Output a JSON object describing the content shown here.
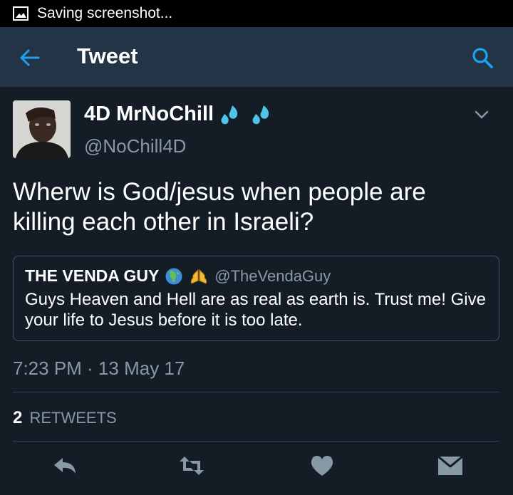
{
  "status_bar": {
    "icon": "image-icon",
    "text": "Saving screenshot..."
  },
  "app_bar": {
    "back_icon": "arrow-left-icon",
    "title": "Tweet",
    "search_icon": "search-icon",
    "accent_color": "#1da1f2"
  },
  "tweet": {
    "author_name": "4D MrNoChill",
    "author_emoji": [
      "sweat-droplets-icon",
      "sweat-droplets-icon"
    ],
    "handle": "@NoChill4D",
    "caret_icon": "chevron-down-icon",
    "text_line1": "Wherw is God/jesus when people  are",
    "text_line2": "killing each other in Israeli?",
    "quoted": {
      "name": "THE VENDA GUY",
      "emoji": [
        "globe-africa-icon",
        "praying-hands-icon"
      ],
      "handle": "@TheVendaGuy",
      "text_line1": "Guys Heaven and Hell are as real as earth is. Trust me!  Give",
      "text_line2": "your life to Jesus before it is too late."
    },
    "timestamp": "7:23 PM · 13 May 17",
    "retweet_count": "2",
    "retweet_label": "RETWEETS"
  },
  "actions": [
    {
      "name": "reply-icon"
    },
    {
      "name": "retweet-icon"
    },
    {
      "name": "like-heart-icon"
    },
    {
      "name": "direct-message-icon"
    }
  ],
  "colors": {
    "background": "#141d26",
    "app_bar": "#243447",
    "secondary_text": "#8899a6",
    "icon_gray": "#8899a6",
    "emoji_blue": "#4fc3e8"
  }
}
